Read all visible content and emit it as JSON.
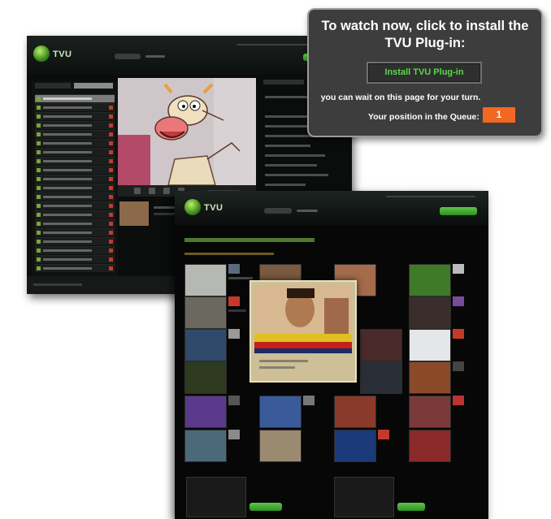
{
  "dialog": {
    "title": "To watch now, click to install the TVU Plug-in:",
    "install_button_label": "Install TVU Plug-in",
    "wait_message": "you can wait on this page for your turn.",
    "queue_label": "Your position in the Queue:",
    "queue_position": "1"
  },
  "colors": {
    "dialog_background": "#3d3d3d",
    "install_button_text": "#5ad84a",
    "queue_badge": "#f26722",
    "player_background": "#0b0c0c"
  },
  "icons": {
    "tvu_logo": "green-globe",
    "player_controls": "control-buttons"
  }
}
